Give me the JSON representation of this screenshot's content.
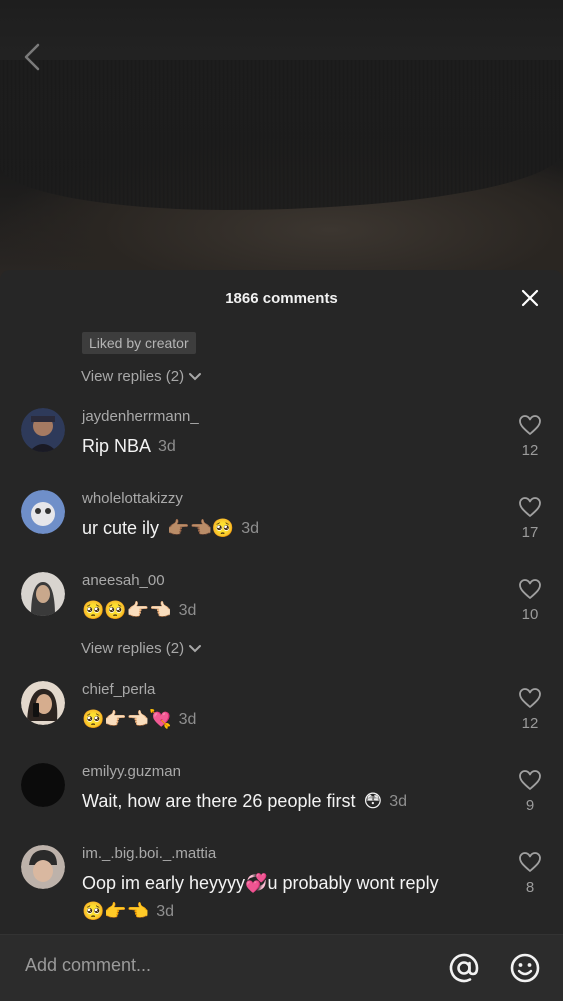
{
  "header": {
    "title": "1866 comments"
  },
  "top": {
    "liked_badge": "Liked by creator",
    "view_replies_1": "View replies (2)"
  },
  "comments": [
    {
      "username": "jaydenherrmann_",
      "text": "Rip NBA",
      "emoji": "",
      "time": "3d",
      "likes": "12",
      "avatar_color": "#4a5a7a"
    },
    {
      "username": "wholelottakizzy",
      "text": "ur cute ily",
      "emoji": "👉🏽👈🏽🥺",
      "time": "3d",
      "likes": "17",
      "avatar_color": "#7b93c4"
    },
    {
      "username": "aneesah_00",
      "text": "",
      "emoji": "🥺🥺👉🏻👈🏻",
      "time": "3d",
      "likes": "10",
      "avatar_color": "#8a7a6e"
    },
    {
      "username": "chief_perla",
      "text": "",
      "emoji": "🥺👉🏻👈🏻💘",
      "time": "3d",
      "likes": "12",
      "avatar_color": "#caa58a"
    },
    {
      "username": "emilyy.guzman",
      "text": "Wait, how are there 26 people first",
      "emoji": "😳",
      "time": "3d",
      "likes": "9",
      "avatar_color": "#0c0c0c"
    },
    {
      "username": "im._.big.boi._.mattia",
      "text": "Oop im early heyyyy💞u probably wont reply",
      "emoji_line2": "🥺👉👈",
      "time": "3d",
      "likes": "8",
      "avatar_color": "#9a8a80"
    }
  ],
  "view_replies_2": "View replies (2)",
  "input": {
    "placeholder": "Add comment..."
  },
  "colors": {
    "sheet_bg": "#262626",
    "input_bg": "#2c2c2c",
    "text_primary": "#f3f3f3",
    "text_secondary": "#a9a9a9"
  },
  "icons": [
    "back-chevron-icon",
    "close-icon",
    "heart-icon",
    "chevron-down-icon",
    "at-mention-icon",
    "smiley-emoji-icon"
  ]
}
